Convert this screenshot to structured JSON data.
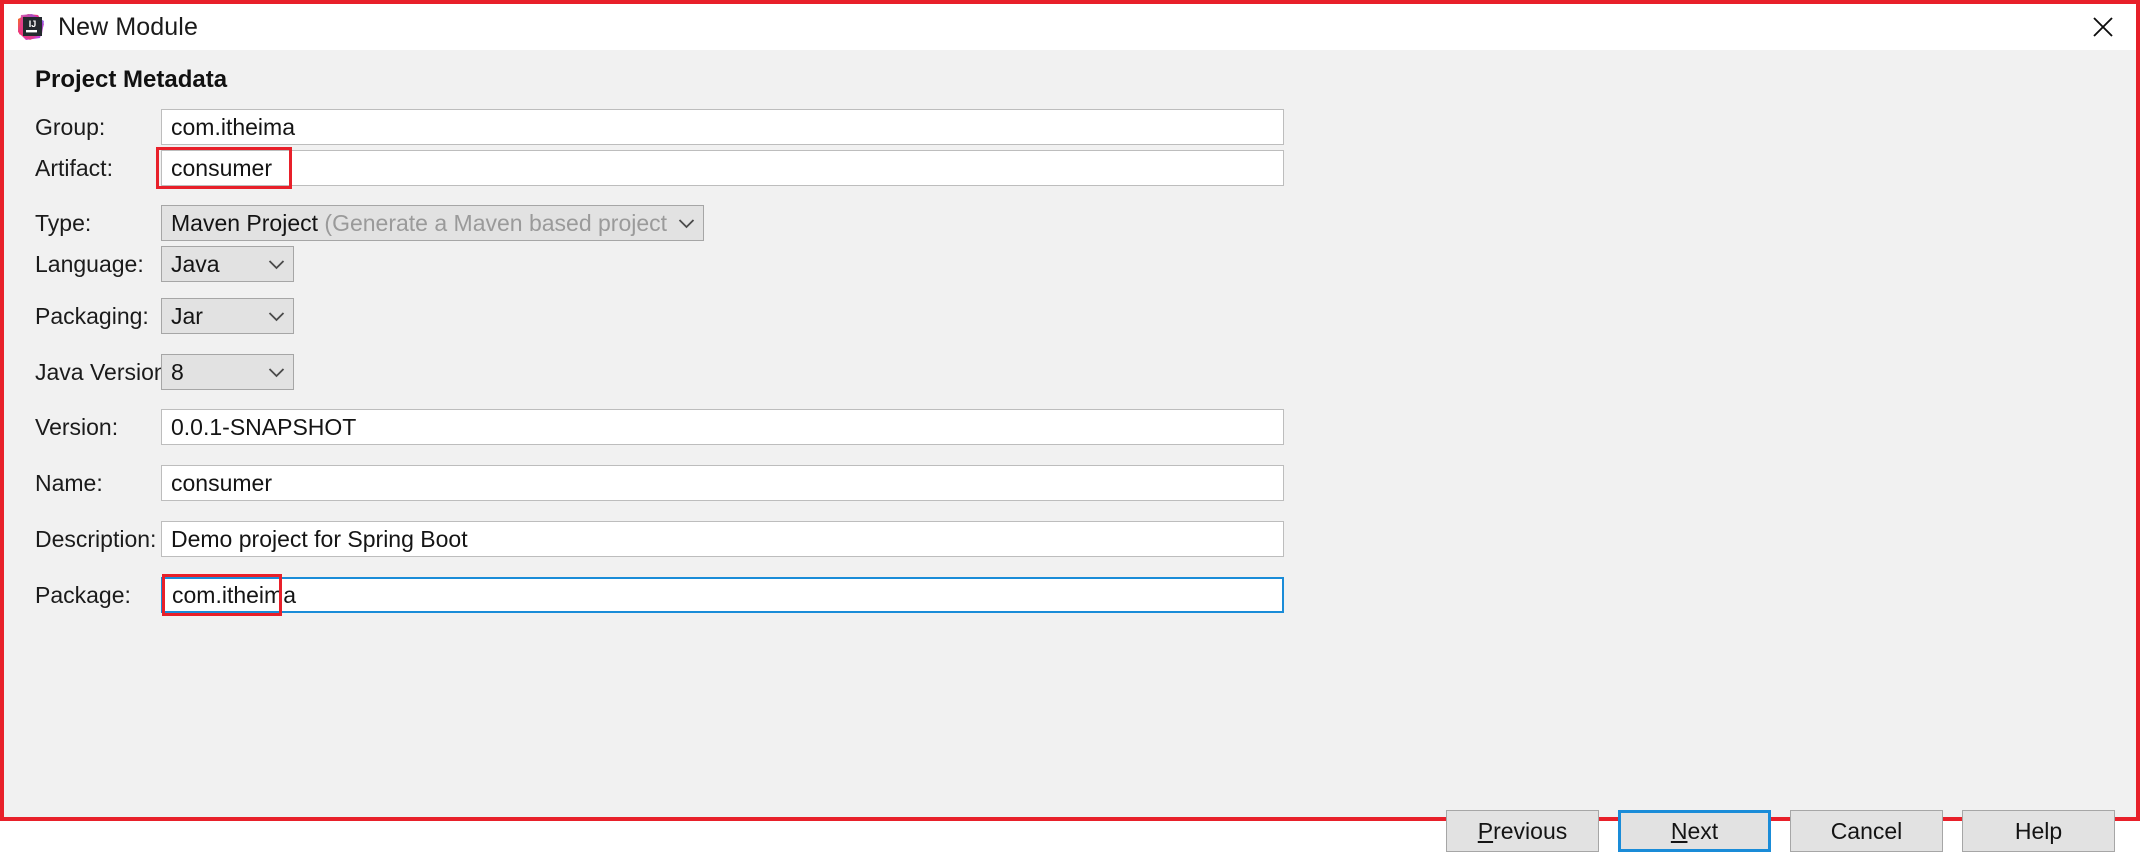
{
  "window": {
    "title": "New Module",
    "app_icon": "intellij-idea-icon",
    "close_icon": "close-icon"
  },
  "form": {
    "heading": "Project Metadata",
    "fields": [
      {
        "label": "Group:",
        "value": "com.itheima",
        "kind": "text"
      },
      {
        "label": "Artifact:",
        "value": "consumer",
        "kind": "text"
      },
      {
        "label": "Type:",
        "value": "Maven Project",
        "hint": "(Generate a Maven based project archive.)",
        "kind": "combo"
      },
      {
        "label": "Language:",
        "value": "Java",
        "kind": "combo"
      },
      {
        "label": "Packaging:",
        "value": "Jar",
        "kind": "combo"
      },
      {
        "label": "Java Version:",
        "value": "8",
        "kind": "combo"
      },
      {
        "label": "Version:",
        "value": "0.0.1-SNAPSHOT",
        "kind": "text"
      },
      {
        "label": "Name:",
        "value": "consumer",
        "kind": "text"
      },
      {
        "label": "Description:",
        "value": "Demo project for Spring Boot",
        "kind": "text"
      },
      {
        "label": "Package:",
        "value": "com.itheima",
        "kind": "text"
      }
    ]
  },
  "buttons": {
    "previous": {
      "prefix": "",
      "accel": "P",
      "suffix": "revious"
    },
    "next": {
      "prefix": "",
      "accel": "N",
      "suffix": "ext"
    },
    "cancel": "Cancel",
    "help": "Help"
  },
  "colors": {
    "annotation_red": "#e8202a",
    "focus_blue": "#1a8cd8",
    "dialog_bg": "#f1f1f1",
    "field_bg": "#ffffff",
    "combo_bg": "#e2e2e2"
  }
}
